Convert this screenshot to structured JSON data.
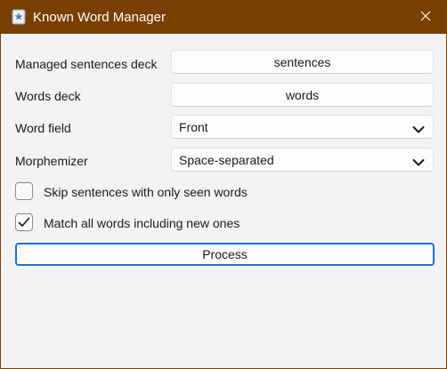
{
  "window": {
    "title": "Known Word Manager",
    "titlebar_color": "#7a3f00",
    "app_icon": "anki-app-icon",
    "close_icon": "close-icon"
  },
  "form": {
    "sentences_deck": {
      "label": "Managed sentences deck",
      "value": "sentences"
    },
    "words_deck": {
      "label": "Words deck",
      "value": "words"
    },
    "word_field": {
      "label": "Word field",
      "value": "Front"
    },
    "morphemizer": {
      "label": "Morphemizer",
      "value": "Space-separated"
    },
    "skip_seen": {
      "label": "Skip sentences with only seen words",
      "checked": false
    },
    "match_all": {
      "label": "Match all words including new ones",
      "checked": true
    },
    "process_label": "Process",
    "accent_color": "#1f6fd1"
  }
}
